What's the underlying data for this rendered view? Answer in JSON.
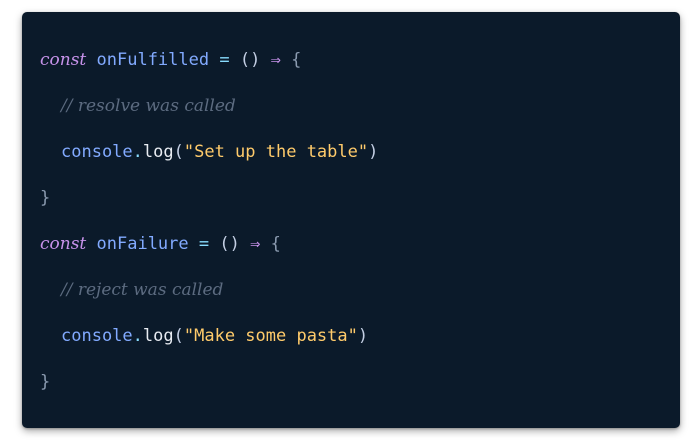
{
  "code_window": {
    "lines": [
      {
        "keyword": "const",
        "name": "onFulfilled",
        "assign": "=",
        "params": "()",
        "arrow": "⇒",
        "open_brace": "{"
      },
      {
        "comment": "// resolve was called"
      },
      {
        "object": "console",
        "dot": ".",
        "method": "log",
        "paren_open": "(",
        "string": "\"Set up the table\"",
        "paren_close": ")"
      },
      {
        "close_brace": "}"
      },
      {
        "keyword": "const",
        "name": "onFailure",
        "assign": "=",
        "params": "()",
        "arrow": "⇒",
        "open_brace": "{"
      },
      {
        "comment": "// reject was called"
      },
      {
        "object": "console",
        "dot": ".",
        "method": "log",
        "paren_open": "(",
        "string": "\"Make some pasta\"",
        "paren_close": ")"
      },
      {
        "close_brace": "}"
      }
    ]
  },
  "colors": {
    "background": "#0b1a2a",
    "keyword": "#c792ea",
    "function_name": "#82aaff",
    "string": "#ffcb6b",
    "comment": "#5c6b80",
    "operator": "#89ddff"
  }
}
